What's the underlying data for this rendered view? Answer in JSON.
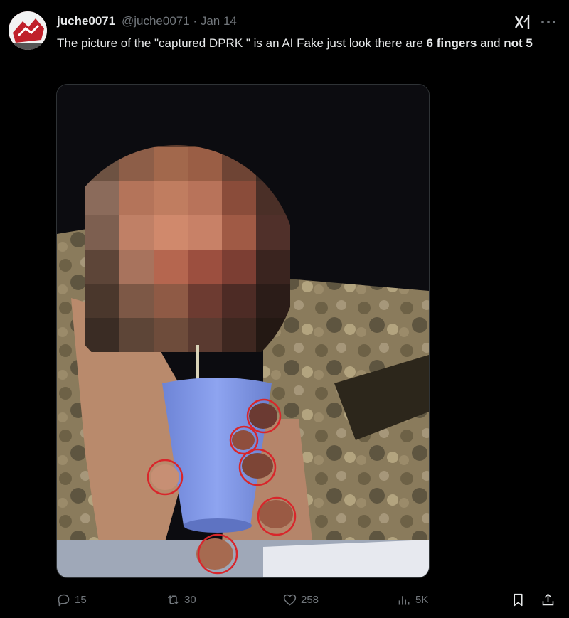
{
  "tweet": {
    "display_name": "juche0071",
    "handle": "@juche0071",
    "separator": "·",
    "date": "Jan 14",
    "text": {
      "part1": "The picture of the \"captured DPRK \" is an AI Fake just look there are ",
      "bold1": "6",
      "bold2": "fingers",
      "part2": " and ",
      "bold3": "not 5"
    }
  },
  "icons": {
    "avatar": "flag-avatar-icon",
    "grok": "grok-icon",
    "more": "more-icon",
    "reply": "reply-icon",
    "repost": "repost-icon",
    "like": "heart-icon",
    "views": "views-icon",
    "bookmark": "bookmark-icon",
    "share": "share-icon"
  },
  "actions": {
    "replies": "15",
    "reposts": "30",
    "likes": "258",
    "views": "5K"
  },
  "colors": {
    "background": "#000000",
    "text_primary": "#e7e9ea",
    "text_secondary": "#71767b",
    "annotation_circle": "#d8262b",
    "cup": "#7f97e8"
  }
}
